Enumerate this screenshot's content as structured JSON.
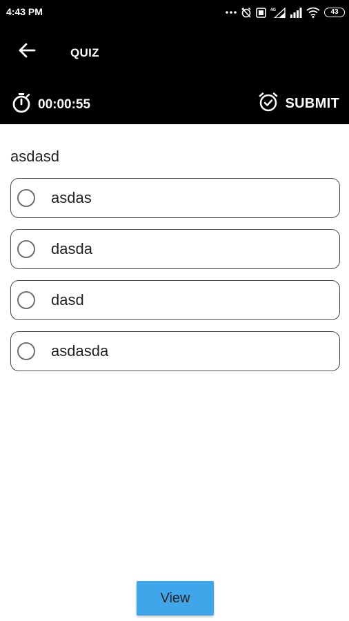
{
  "status_bar": {
    "time": "4:43 PM",
    "battery": "43",
    "icons": [
      "dots-icon",
      "alarm-off-icon",
      "data-saver-icon",
      "signal-4g-icon",
      "signal-icon",
      "wifi-icon",
      "battery-icon"
    ]
  },
  "header": {
    "title": "QUIZ",
    "back_icon": "arrow-left-icon"
  },
  "timer": {
    "value": "00:00:55",
    "icon": "stopwatch-icon"
  },
  "submit": {
    "label": "SUBMIT",
    "icon": "alarm-check-icon"
  },
  "question": {
    "text": "asdasd",
    "options": [
      {
        "label": "asdas"
      },
      {
        "label": "dasda"
      },
      {
        "label": "dasd"
      },
      {
        "label": "asdasda"
      }
    ]
  },
  "view_button": {
    "label": "View"
  },
  "colors": {
    "topbar": "#000000",
    "view_button": "#3fa6ea",
    "border": "#4a4a4a"
  }
}
